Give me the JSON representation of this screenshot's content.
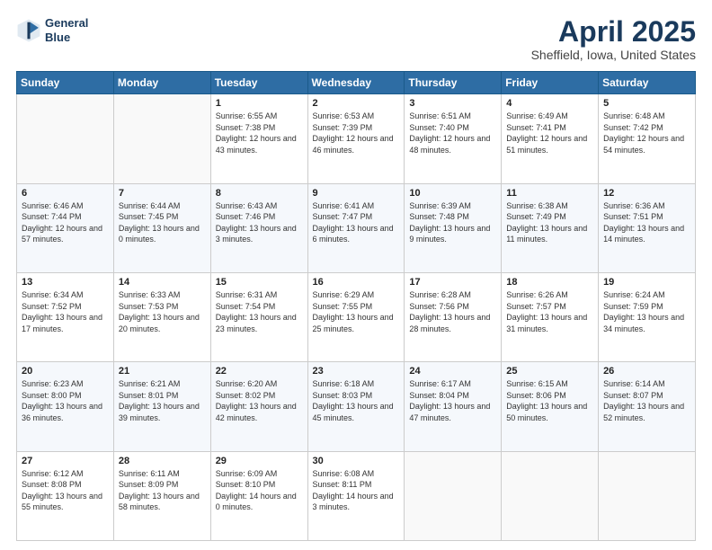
{
  "logo": {
    "line1": "General",
    "line2": "Blue"
  },
  "title": "April 2025",
  "subtitle": "Sheffield, Iowa, United States",
  "days_header": [
    "Sunday",
    "Monday",
    "Tuesday",
    "Wednesday",
    "Thursday",
    "Friday",
    "Saturday"
  ],
  "weeks": [
    [
      {
        "num": "",
        "info": ""
      },
      {
        "num": "",
        "info": ""
      },
      {
        "num": "1",
        "info": "Sunrise: 6:55 AM\nSunset: 7:38 PM\nDaylight: 12 hours and 43 minutes."
      },
      {
        "num": "2",
        "info": "Sunrise: 6:53 AM\nSunset: 7:39 PM\nDaylight: 12 hours and 46 minutes."
      },
      {
        "num": "3",
        "info": "Sunrise: 6:51 AM\nSunset: 7:40 PM\nDaylight: 12 hours and 48 minutes."
      },
      {
        "num": "4",
        "info": "Sunrise: 6:49 AM\nSunset: 7:41 PM\nDaylight: 12 hours and 51 minutes."
      },
      {
        "num": "5",
        "info": "Sunrise: 6:48 AM\nSunset: 7:42 PM\nDaylight: 12 hours and 54 minutes."
      }
    ],
    [
      {
        "num": "6",
        "info": "Sunrise: 6:46 AM\nSunset: 7:44 PM\nDaylight: 12 hours and 57 minutes."
      },
      {
        "num": "7",
        "info": "Sunrise: 6:44 AM\nSunset: 7:45 PM\nDaylight: 13 hours and 0 minutes."
      },
      {
        "num": "8",
        "info": "Sunrise: 6:43 AM\nSunset: 7:46 PM\nDaylight: 13 hours and 3 minutes."
      },
      {
        "num": "9",
        "info": "Sunrise: 6:41 AM\nSunset: 7:47 PM\nDaylight: 13 hours and 6 minutes."
      },
      {
        "num": "10",
        "info": "Sunrise: 6:39 AM\nSunset: 7:48 PM\nDaylight: 13 hours and 9 minutes."
      },
      {
        "num": "11",
        "info": "Sunrise: 6:38 AM\nSunset: 7:49 PM\nDaylight: 13 hours and 11 minutes."
      },
      {
        "num": "12",
        "info": "Sunrise: 6:36 AM\nSunset: 7:51 PM\nDaylight: 13 hours and 14 minutes."
      }
    ],
    [
      {
        "num": "13",
        "info": "Sunrise: 6:34 AM\nSunset: 7:52 PM\nDaylight: 13 hours and 17 minutes."
      },
      {
        "num": "14",
        "info": "Sunrise: 6:33 AM\nSunset: 7:53 PM\nDaylight: 13 hours and 20 minutes."
      },
      {
        "num": "15",
        "info": "Sunrise: 6:31 AM\nSunset: 7:54 PM\nDaylight: 13 hours and 23 minutes."
      },
      {
        "num": "16",
        "info": "Sunrise: 6:29 AM\nSunset: 7:55 PM\nDaylight: 13 hours and 25 minutes."
      },
      {
        "num": "17",
        "info": "Sunrise: 6:28 AM\nSunset: 7:56 PM\nDaylight: 13 hours and 28 minutes."
      },
      {
        "num": "18",
        "info": "Sunrise: 6:26 AM\nSunset: 7:57 PM\nDaylight: 13 hours and 31 minutes."
      },
      {
        "num": "19",
        "info": "Sunrise: 6:24 AM\nSunset: 7:59 PM\nDaylight: 13 hours and 34 minutes."
      }
    ],
    [
      {
        "num": "20",
        "info": "Sunrise: 6:23 AM\nSunset: 8:00 PM\nDaylight: 13 hours and 36 minutes."
      },
      {
        "num": "21",
        "info": "Sunrise: 6:21 AM\nSunset: 8:01 PM\nDaylight: 13 hours and 39 minutes."
      },
      {
        "num": "22",
        "info": "Sunrise: 6:20 AM\nSunset: 8:02 PM\nDaylight: 13 hours and 42 minutes."
      },
      {
        "num": "23",
        "info": "Sunrise: 6:18 AM\nSunset: 8:03 PM\nDaylight: 13 hours and 45 minutes."
      },
      {
        "num": "24",
        "info": "Sunrise: 6:17 AM\nSunset: 8:04 PM\nDaylight: 13 hours and 47 minutes."
      },
      {
        "num": "25",
        "info": "Sunrise: 6:15 AM\nSunset: 8:06 PM\nDaylight: 13 hours and 50 minutes."
      },
      {
        "num": "26",
        "info": "Sunrise: 6:14 AM\nSunset: 8:07 PM\nDaylight: 13 hours and 52 minutes."
      }
    ],
    [
      {
        "num": "27",
        "info": "Sunrise: 6:12 AM\nSunset: 8:08 PM\nDaylight: 13 hours and 55 minutes."
      },
      {
        "num": "28",
        "info": "Sunrise: 6:11 AM\nSunset: 8:09 PM\nDaylight: 13 hours and 58 minutes."
      },
      {
        "num": "29",
        "info": "Sunrise: 6:09 AM\nSunset: 8:10 PM\nDaylight: 14 hours and 0 minutes."
      },
      {
        "num": "30",
        "info": "Sunrise: 6:08 AM\nSunset: 8:11 PM\nDaylight: 14 hours and 3 minutes."
      },
      {
        "num": "",
        "info": ""
      },
      {
        "num": "",
        "info": ""
      },
      {
        "num": "",
        "info": ""
      }
    ]
  ]
}
